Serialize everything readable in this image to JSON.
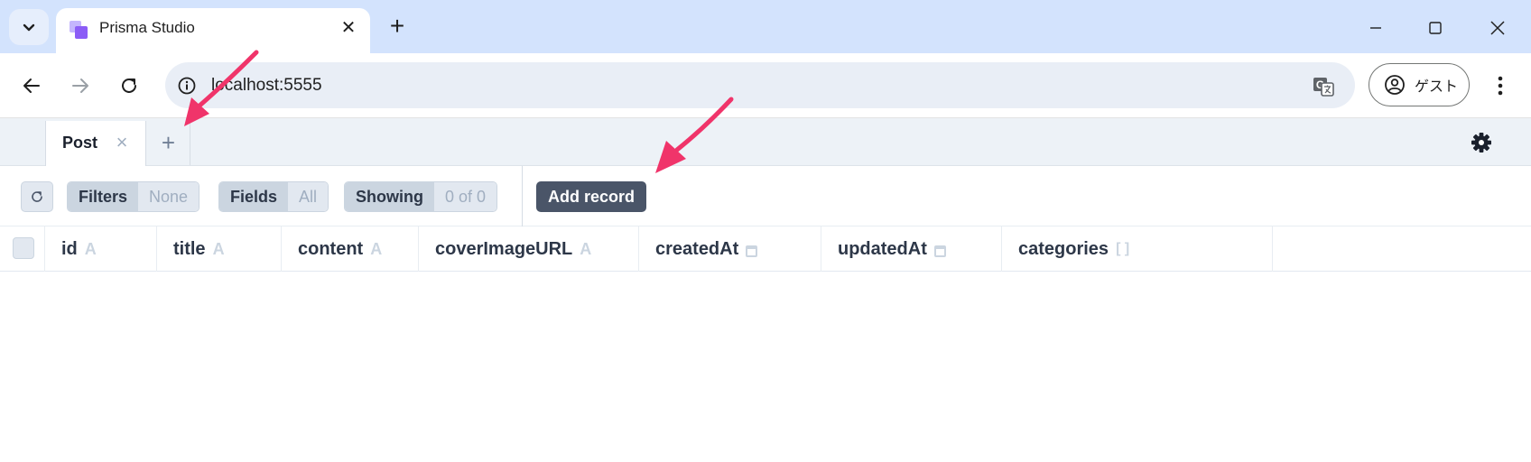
{
  "browser": {
    "tab_title": "Prisma Studio",
    "tab_close": "✕",
    "new_tab": "+",
    "url": "localhost:5555",
    "profile_label": "ゲスト"
  },
  "studio": {
    "model_tab": "Post",
    "model_tab_close": "×",
    "add_tab": "+",
    "filters": {
      "label": "Filters",
      "value": "None"
    },
    "fields": {
      "label": "Fields",
      "value": "All"
    },
    "showing": {
      "label": "Showing",
      "value": "0 of 0"
    },
    "add_record": "Add record",
    "columns": [
      {
        "name": "id",
        "type": "A"
      },
      {
        "name": "title",
        "type": "A"
      },
      {
        "name": "content",
        "type": "A"
      },
      {
        "name": "coverImageURL",
        "type": "A"
      },
      {
        "name": "createdAt",
        "type": "date-icon"
      },
      {
        "name": "updatedAt",
        "type": "date-icon"
      },
      {
        "name": "categories",
        "type": "[ ]"
      }
    ]
  },
  "colors": {
    "annotation_arrow": "#f0346a",
    "add_record_bg": "#4a5568",
    "tabstrip_bg": "#d3e3fd"
  }
}
